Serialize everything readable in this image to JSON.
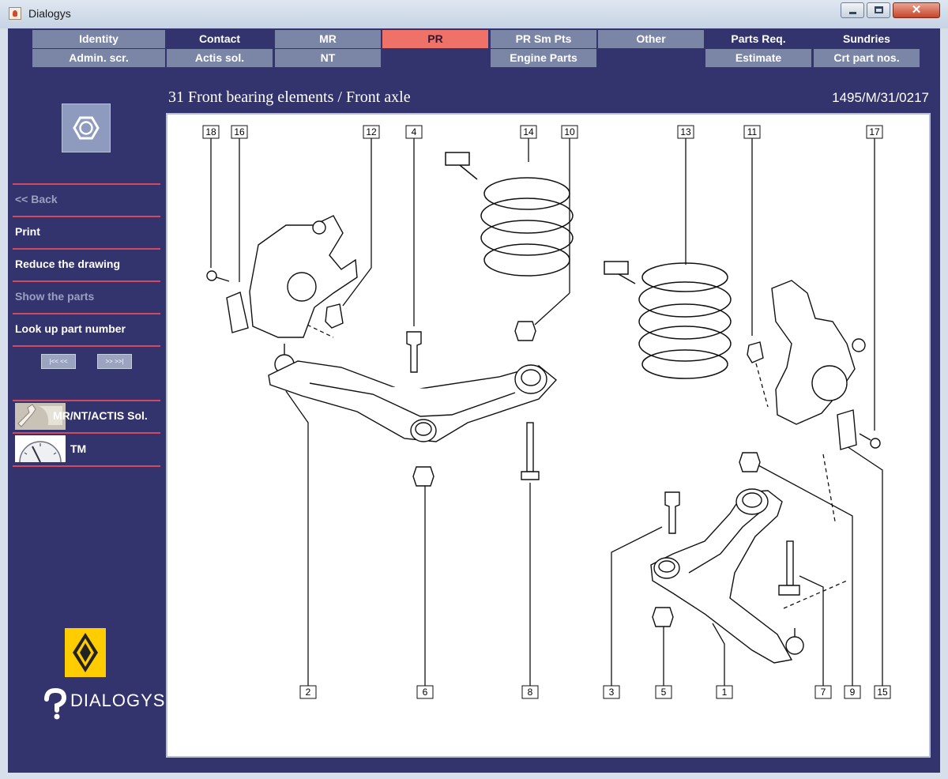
{
  "window": {
    "title": "Dialogys",
    "close_glyph": "✕"
  },
  "tabs": {
    "row1": [
      "Identity",
      "Contact",
      "MR",
      "PR",
      "PR Sm Pts",
      "Other",
      "Parts Req.",
      "Sundries"
    ],
    "row2": [
      "Admin. scr.",
      "Actis sol.",
      "NT",
      "",
      "Engine Parts",
      "",
      "Estimate",
      "Crt part nos."
    ],
    "active": "PR"
  },
  "sidebar": {
    "logo_icon": "hex-nut-icon",
    "back": "<< Back",
    "print": "Print",
    "reduce": "Reduce the drawing",
    "show_parts": "Show the parts",
    "lookup": "Look up part number",
    "nav_first": "|<<",
    "nav_prev": "<<",
    "nav_next": ">>",
    "nav_last": ">>|",
    "modules": [
      {
        "icon": "wrench-icon",
        "label": "MR/NT/ACTIS Sol."
      },
      {
        "icon": "gauge-icon",
        "label": "TM"
      }
    ],
    "brand": "DIALOGYS"
  },
  "header": {
    "title": "31 Front bearing elements / Front axle",
    "code": "1495/M/31/0217"
  },
  "drawing": {
    "top_callouts": [
      "18",
      "16",
      "12",
      "4",
      "14",
      "10",
      "13",
      "11",
      "17"
    ],
    "bottom_callouts": [
      "2",
      "6",
      "8",
      "3",
      "5",
      "1",
      "7",
      "9",
      "15"
    ]
  }
}
